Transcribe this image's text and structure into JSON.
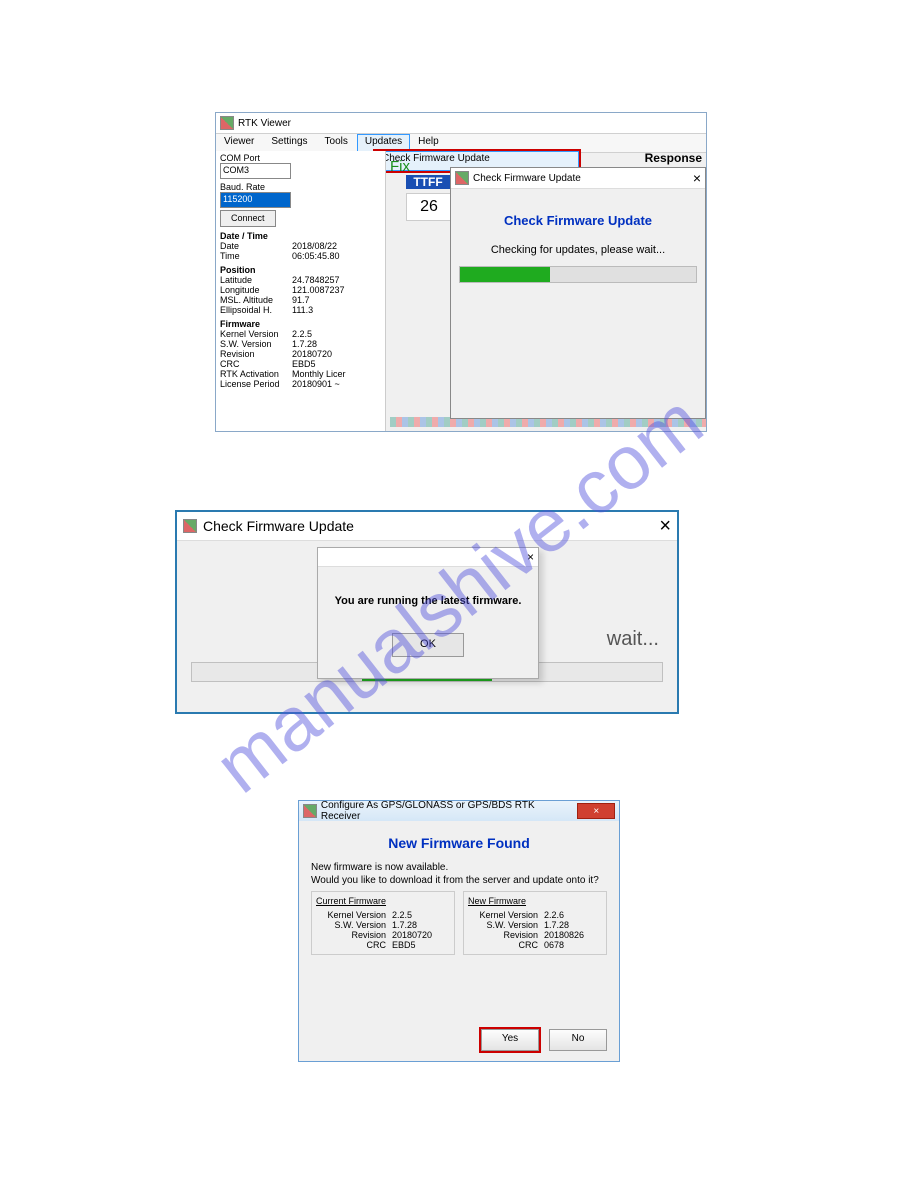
{
  "watermark": "manualshive.com",
  "shot1": {
    "window_title": "RTK Viewer",
    "menubar": [
      "Viewer",
      "Settings",
      "Tools",
      "Updates",
      "Help"
    ],
    "submenu_label": "Check Firmware Update",
    "com_port_label": "COM Port",
    "com_port_value": "COM3",
    "baud_label": "Baud. Rate",
    "baud_value": "115200",
    "connect_label": "Connect",
    "fix_label": "Fix",
    "ttff_label": "TTFF",
    "ttff_value": "26",
    "response_label": "Response",
    "section_datetime": "Date / Time",
    "date_k": "Date",
    "date_v": "2018/08/22",
    "time_k": "Time",
    "time_v": "06:05:45.80",
    "section_position": "Position",
    "lat_k": "Latitude",
    "lat_v": "24.7848257",
    "lon_k": "Longitude",
    "lon_v": "121.0087237",
    "msl_k": "MSL. Altitude",
    "msl_v": "91.7",
    "ell_k": "Ellipsoidal H.",
    "ell_v": "111.3",
    "section_fw": "Firmware",
    "kv_k": "Kernel Version",
    "kv_v": "2.2.5",
    "sw_k": "S.W. Version",
    "sw_v": "1.7.28",
    "rev_k": "Revision",
    "rev_v": "20180720",
    "crc_k": "CRC",
    "crc_v": "EBD5",
    "rtk_k": "RTK Activation",
    "rtk_v": "Monthly Licer",
    "lic_k": "License Period",
    "lic_v": "20180901 ~",
    "dlg_title": "Check Firmware Update",
    "dlg_heading": "Check Firmware Update",
    "dlg_msg": "Checking for updates, please wait...",
    "close_x": "×"
  },
  "shot2": {
    "window_title": "Check Firmware Update",
    "close_x": "×",
    "bg_wait": "wait...",
    "msg": "You are running the latest firmware.",
    "ok_label": "OK"
  },
  "shot3": {
    "window_title": "Configure As GPS/GLONASS or GPS/BDS RTK Receiver",
    "close_x": "×",
    "heading": "New Firmware Found",
    "msg_l1": "New firmware is now available.",
    "msg_l2": "Would you like to download it from the server and update onto it?",
    "col_current": "Current Firmware",
    "col_new": "New Firmware",
    "kv_k": "Kernel Version",
    "sw_k": "S.W. Version",
    "rev_k": "Revision",
    "crc_k": "CRC",
    "cur": {
      "kv": "2.2.5",
      "sw": "1.7.28",
      "rev": "20180720",
      "crc": "EBD5"
    },
    "new": {
      "kv": "2.2.6",
      "sw": "1.7.28",
      "rev": "20180826",
      "crc": "0678"
    },
    "yes_label": "Yes",
    "no_label": "No"
  }
}
